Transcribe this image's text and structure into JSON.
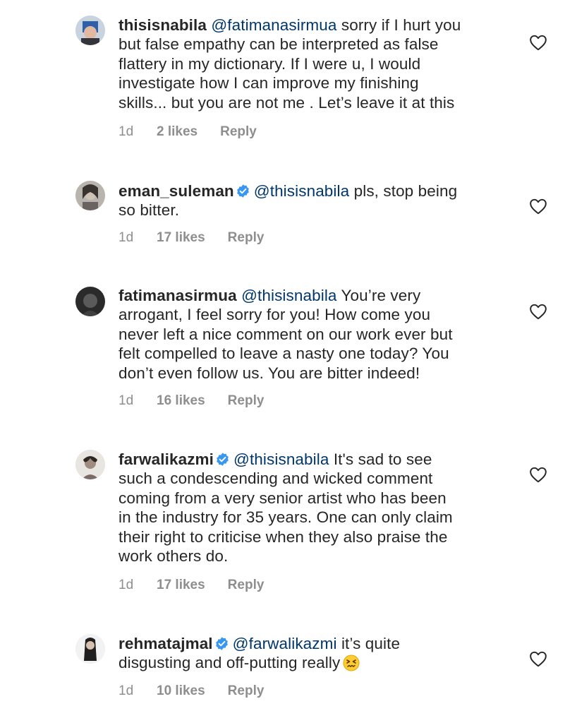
{
  "comments": [
    {
      "username": "thisisnabila",
      "verified": false,
      "mention": "@fatimanasirmua",
      "body": " sorry if I hurt you\nbut false empathy can be interpreted as false\nflattery in my dictionary. If I were u, I would\ninvestigate how I can improve my finishing\nskills... but you are not me . Let’s leave it at this",
      "time": "1d",
      "likes": "2 likes",
      "reply": "Reply"
    },
    {
      "username": "eman_suleman",
      "verified": true,
      "mention": "@thisisnabila",
      "body": " pls, stop being\nso bitter.",
      "time": "1d",
      "likes": "17 likes",
      "reply": "Reply"
    },
    {
      "username": "fatimanasirmua",
      "verified": false,
      "mention": "@thisisnabila",
      "body": " You’re very\narrogant, I feel sorry for you! How come you\nnever left a nice comment on our work ever but\nfelt compelled to leave a nasty one today? You\ndon’t even follow us. You are bitter indeed!",
      "time": "1d",
      "likes": "16 likes",
      "reply": "Reply"
    },
    {
      "username": "farwalikazmi",
      "verified": true,
      "mention": "@thisisnabila",
      "body": " It's sad to see\nsuch a condescending and wicked comment\ncoming from a very senior artist who has been\nin the industry for 35 years. One can only claim\ntheir right to criticise when they also praise the\nwork others do.",
      "time": "1d",
      "likes": "17 likes",
      "reply": "Reply"
    },
    {
      "username": "rehmatajmal",
      "verified": true,
      "mention": "@farwalikazmi",
      "body": " it’s quite\ndisgusting and off-putting really",
      "emoji": "confounded-face",
      "time": "1d",
      "likes": "10 likes",
      "reply": "Reply"
    }
  ],
  "colors": {
    "text": "#262626",
    "mention": "#00376b",
    "meta": "#8e8e8e",
    "verified": "#3897f0"
  }
}
